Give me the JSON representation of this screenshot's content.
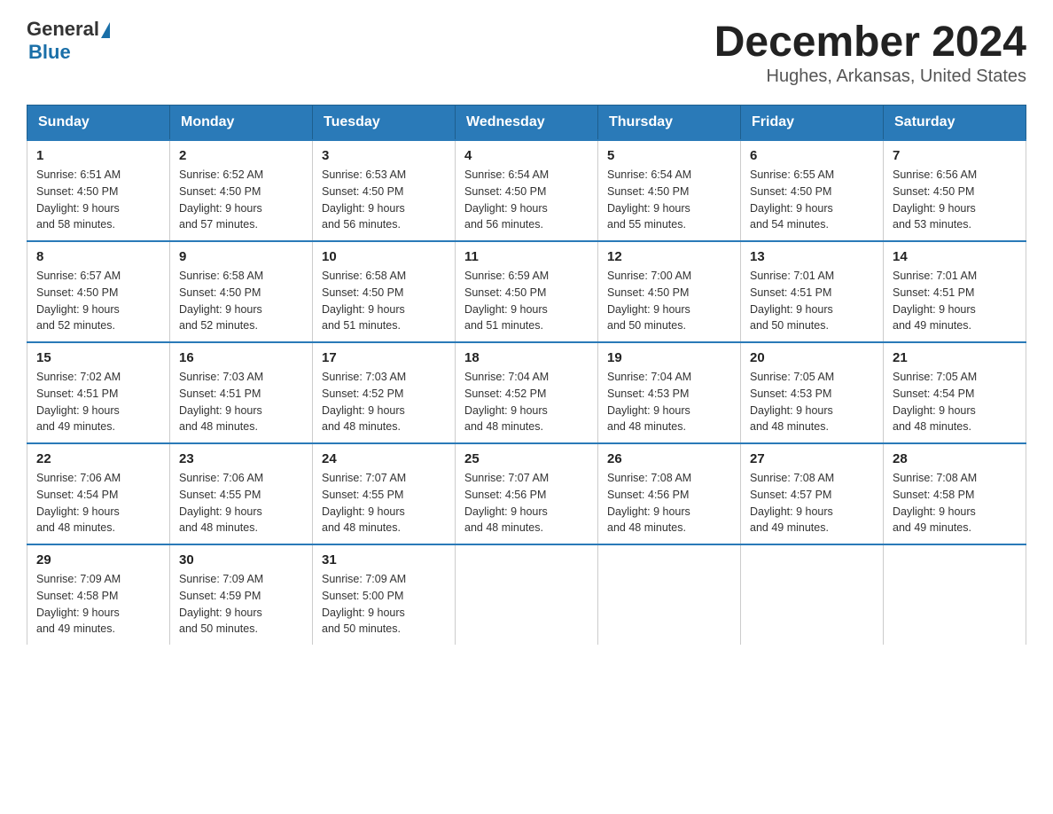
{
  "logo": {
    "text_general": "General",
    "text_blue": "Blue"
  },
  "header": {
    "month_year": "December 2024",
    "location": "Hughes, Arkansas, United States"
  },
  "days_of_week": [
    "Sunday",
    "Monday",
    "Tuesday",
    "Wednesday",
    "Thursday",
    "Friday",
    "Saturday"
  ],
  "weeks": [
    [
      {
        "day": "1",
        "sunrise": "6:51 AM",
        "sunset": "4:50 PM",
        "daylight": "9 hours and 58 minutes."
      },
      {
        "day": "2",
        "sunrise": "6:52 AM",
        "sunset": "4:50 PM",
        "daylight": "9 hours and 57 minutes."
      },
      {
        "day": "3",
        "sunrise": "6:53 AM",
        "sunset": "4:50 PM",
        "daylight": "9 hours and 56 minutes."
      },
      {
        "day": "4",
        "sunrise": "6:54 AM",
        "sunset": "4:50 PM",
        "daylight": "9 hours and 56 minutes."
      },
      {
        "day": "5",
        "sunrise": "6:54 AM",
        "sunset": "4:50 PM",
        "daylight": "9 hours and 55 minutes."
      },
      {
        "day": "6",
        "sunrise": "6:55 AM",
        "sunset": "4:50 PM",
        "daylight": "9 hours and 54 minutes."
      },
      {
        "day": "7",
        "sunrise": "6:56 AM",
        "sunset": "4:50 PM",
        "daylight": "9 hours and 53 minutes."
      }
    ],
    [
      {
        "day": "8",
        "sunrise": "6:57 AM",
        "sunset": "4:50 PM",
        "daylight": "9 hours and 52 minutes."
      },
      {
        "day": "9",
        "sunrise": "6:58 AM",
        "sunset": "4:50 PM",
        "daylight": "9 hours and 52 minutes."
      },
      {
        "day": "10",
        "sunrise": "6:58 AM",
        "sunset": "4:50 PM",
        "daylight": "9 hours and 51 minutes."
      },
      {
        "day": "11",
        "sunrise": "6:59 AM",
        "sunset": "4:50 PM",
        "daylight": "9 hours and 51 minutes."
      },
      {
        "day": "12",
        "sunrise": "7:00 AM",
        "sunset": "4:50 PM",
        "daylight": "9 hours and 50 minutes."
      },
      {
        "day": "13",
        "sunrise": "7:01 AM",
        "sunset": "4:51 PM",
        "daylight": "9 hours and 50 minutes."
      },
      {
        "day": "14",
        "sunrise": "7:01 AM",
        "sunset": "4:51 PM",
        "daylight": "9 hours and 49 minutes."
      }
    ],
    [
      {
        "day": "15",
        "sunrise": "7:02 AM",
        "sunset": "4:51 PM",
        "daylight": "9 hours and 49 minutes."
      },
      {
        "day": "16",
        "sunrise": "7:03 AM",
        "sunset": "4:51 PM",
        "daylight": "9 hours and 48 minutes."
      },
      {
        "day": "17",
        "sunrise": "7:03 AM",
        "sunset": "4:52 PM",
        "daylight": "9 hours and 48 minutes."
      },
      {
        "day": "18",
        "sunrise": "7:04 AM",
        "sunset": "4:52 PM",
        "daylight": "9 hours and 48 minutes."
      },
      {
        "day": "19",
        "sunrise": "7:04 AM",
        "sunset": "4:53 PM",
        "daylight": "9 hours and 48 minutes."
      },
      {
        "day": "20",
        "sunrise": "7:05 AM",
        "sunset": "4:53 PM",
        "daylight": "9 hours and 48 minutes."
      },
      {
        "day": "21",
        "sunrise": "7:05 AM",
        "sunset": "4:54 PM",
        "daylight": "9 hours and 48 minutes."
      }
    ],
    [
      {
        "day": "22",
        "sunrise": "7:06 AM",
        "sunset": "4:54 PM",
        "daylight": "9 hours and 48 minutes."
      },
      {
        "day": "23",
        "sunrise": "7:06 AM",
        "sunset": "4:55 PM",
        "daylight": "9 hours and 48 minutes."
      },
      {
        "day": "24",
        "sunrise": "7:07 AM",
        "sunset": "4:55 PM",
        "daylight": "9 hours and 48 minutes."
      },
      {
        "day": "25",
        "sunrise": "7:07 AM",
        "sunset": "4:56 PM",
        "daylight": "9 hours and 48 minutes."
      },
      {
        "day": "26",
        "sunrise": "7:08 AM",
        "sunset": "4:56 PM",
        "daylight": "9 hours and 48 minutes."
      },
      {
        "day": "27",
        "sunrise": "7:08 AM",
        "sunset": "4:57 PM",
        "daylight": "9 hours and 49 minutes."
      },
      {
        "day": "28",
        "sunrise": "7:08 AM",
        "sunset": "4:58 PM",
        "daylight": "9 hours and 49 minutes."
      }
    ],
    [
      {
        "day": "29",
        "sunrise": "7:09 AM",
        "sunset": "4:58 PM",
        "daylight": "9 hours and 49 minutes."
      },
      {
        "day": "30",
        "sunrise": "7:09 AM",
        "sunset": "4:59 PM",
        "daylight": "9 hours and 50 minutes."
      },
      {
        "day": "31",
        "sunrise": "7:09 AM",
        "sunset": "5:00 PM",
        "daylight": "9 hours and 50 minutes."
      },
      null,
      null,
      null,
      null
    ]
  ],
  "labels": {
    "sunrise": "Sunrise:",
    "sunset": "Sunset:",
    "daylight": "Daylight:"
  }
}
